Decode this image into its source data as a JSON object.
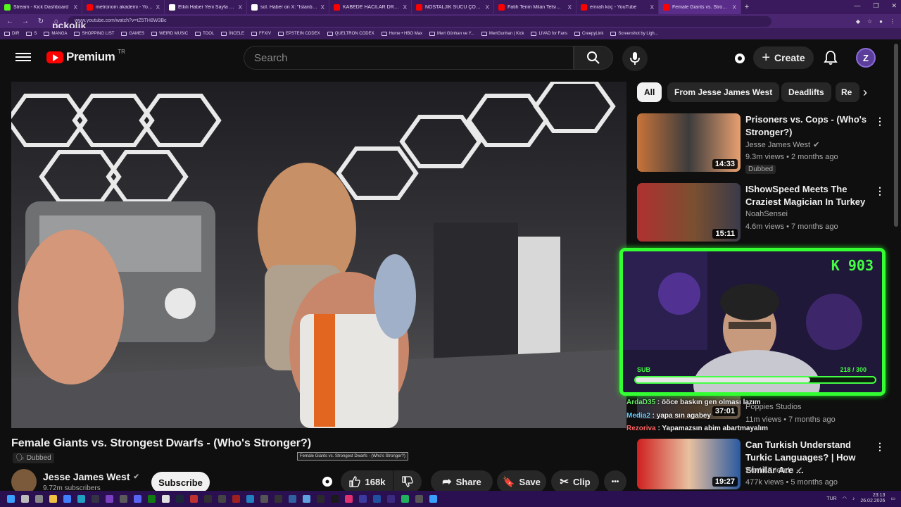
{
  "browser": {
    "tabs": [
      {
        "label": "Stream - Kick Dashboard",
        "fav_color": "#53fc18",
        "active": false
      },
      {
        "label": "metronom akademi - YouTube",
        "fav_color": "#ff0000",
        "active": false
      },
      {
        "label": "Etkili Haber Yeni Sayfa on X: \"Mu...",
        "fav_color": "#ffffff",
        "active": false
      },
      {
        "label": "sol. Haber on X: \"İstanbul'da orta...",
        "fav_color": "#ffffff",
        "active": false
      },
      {
        "label": "KABEDE HACILAR DRILL REMIX(p...",
        "fav_color": "#ff0000",
        "active": false
      },
      {
        "label": "NOSTALJİK SUCU ÇOCUK 1995 fi...",
        "fav_color": "#ff0000",
        "active": false
      },
      {
        "label": "Fatih Terim Milan Telsim Reklamı...",
        "fav_color": "#ff0000",
        "active": false
      },
      {
        "label": "emrah koç - YouTube",
        "fav_color": "#ff0000",
        "active": false
      },
      {
        "label": "Female Giants vs. Strongest...",
        "fav_color": "#ff0000",
        "active": true
      }
    ],
    "new_tab_label": "+",
    "tab_close": "X",
    "window_controls": [
      "—",
      "❐",
      "✕"
    ],
    "url": "www.youtube.com/watch?v=tZ5TH8W3Bc",
    "overlay_watermark": "pckolik",
    "bookmarks": [
      "DIR",
      "S",
      "MANGA",
      "SHOPPING LIST",
      "GAMES",
      "WEIRD MUSIC",
      "TOOL",
      "İNCELE",
      "FFXIV",
      "EPSTEIN CODEX",
      "QUELTRON CODEX",
      "Home • HBO Max",
      "Mert Günhan ve Y...",
      "MertGunhan | Kick",
      "LIVAD for Fans",
      "CreepyLink",
      "Screenshot by Ligh..."
    ]
  },
  "header": {
    "logo_text": "Premium",
    "logo_country": "TR",
    "search_placeholder": "Search",
    "create_label": "Create",
    "avatar_letter": "Z"
  },
  "video": {
    "title": "Female Giants vs. Strongest Dwarfs - (Who's Stronger?)",
    "tooltip": "Female Giants vs. Strongest Dwarfs - (Who's Stronger?)",
    "dubbed_label": "Dubbed",
    "channel_name": "Jesse James West",
    "channel_subs": "9.72m subscribers",
    "subscribe_label": "Subscribe",
    "like_count": "168k",
    "share_label": "Share",
    "save_label": "Save",
    "clip_label": "Clip",
    "more_label": "•••"
  },
  "chips": [
    "All",
    "From Jesse James West",
    "Deadlifts",
    "Re"
  ],
  "recommendations": [
    {
      "title": "Prisoners vs. Cops - (Who's Stronger?)",
      "channel": "Jesse James West",
      "verified": true,
      "meta": "9.3m views • 2 months ago",
      "duration": "14:33",
      "badge": "Dubbed",
      "thumb_colors": [
        "#c8743a",
        "#3c3c3c",
        "#e8a070"
      ]
    },
    {
      "title": "IShowSpeed Meets The Craziest Magician In Turkey",
      "channel": "NoahSensei",
      "verified": false,
      "meta": "4.6m views • 7 months ago",
      "duration": "15:11",
      "badge": "",
      "thumb_colors": [
        "#b03030",
        "#7a5030",
        "#3a3a4a"
      ]
    },
    {
      "title": "",
      "channel": "Poppies Studios",
      "verified": false,
      "meta": "11m views • 7 months ago",
      "duration": "37:01",
      "badge": "",
      "thumb_colors": [
        "#2a2a3a",
        "#4a3a2a",
        "#6a5a4a"
      ]
    },
    {
      "title": "Can Turkish Understand Turkic Languages? | How Similar Are ...",
      "channel": "World Friends",
      "verified": true,
      "meta": "477k views • 5 months ago",
      "duration": "19:27",
      "badge": "",
      "thumb_colors": [
        "#d02020",
        "#e8c0a0",
        "#2a5aa0"
      ]
    }
  ],
  "stream_overlay": {
    "sub_label": "SUB",
    "sub_count": "218 / 300",
    "sub_fraction": 0.73,
    "kick_counter": "K 903"
  },
  "chat": [
    {
      "user": "ArdaD35",
      "user_color": "#66ee66",
      "text": " : ööce baskın gen olması lazım"
    },
    {
      "user": "Media2",
      "user_color": "#66ccff",
      "text": " : yapa sın agabey"
    },
    {
      "user": "Rezoriva",
      "user_color": "#ff6666",
      "text": " : Yapamazsın abim abartmayalım"
    }
  ],
  "taskbar": {
    "lang": "TUR",
    "time": "23:13",
    "date": "26.02.2026"
  },
  "colors": {
    "yt_bg": "#0f0f0f",
    "yt_red": "#ff0000",
    "overlay_green": "#33ff33",
    "browser_purple": "#3a1a5c"
  }
}
